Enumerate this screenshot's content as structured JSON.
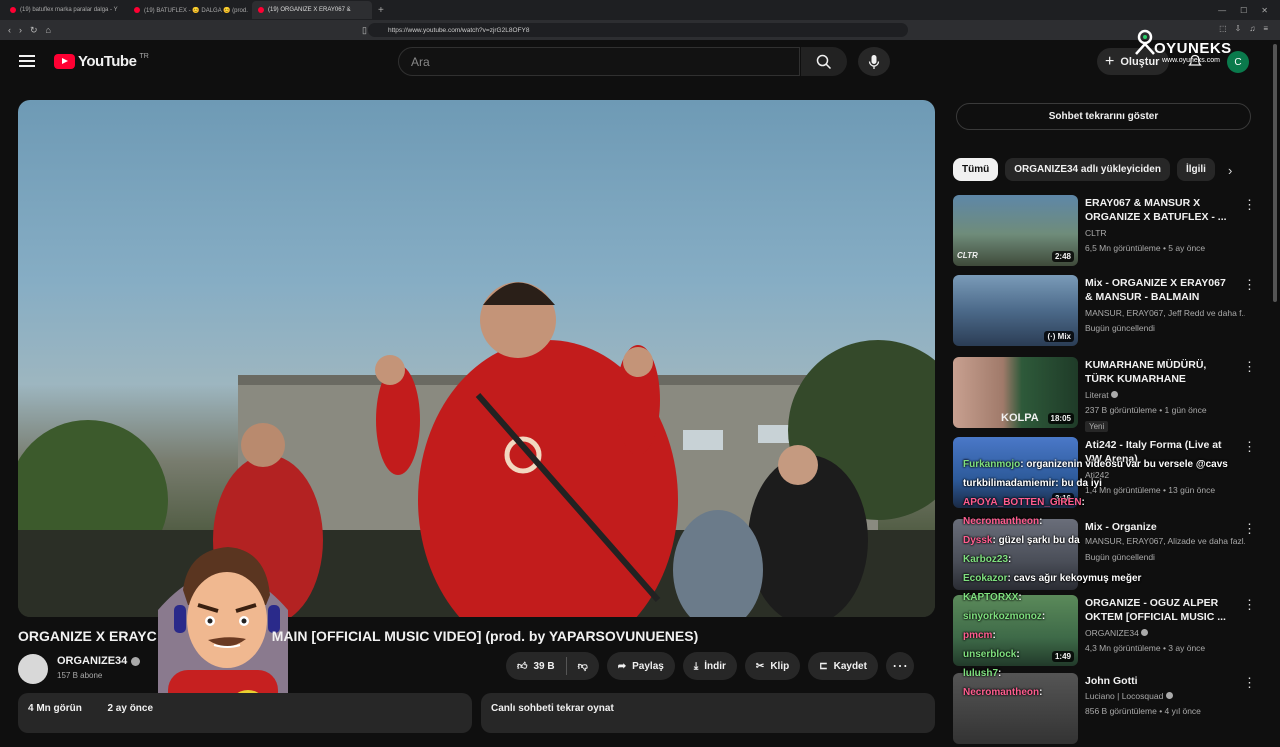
{
  "browser": {
    "tabs": [
      {
        "label": "(19) batuflex marka paralar dalga - Y"
      },
      {
        "label": "(19) BATUFLEX - 😊 DALGA 😊 (prod."
      },
      {
        "label": "(19) ORGANIZE X ERAY067 &"
      }
    ],
    "url": "https://www.youtube.com/watch?v=zjrG2L8OFY8"
  },
  "header": {
    "logo_text": "YouTube",
    "country_code": "TR",
    "search_placeholder": "Ara",
    "create_label": "Oluştur",
    "avatar_letter": "C"
  },
  "watermark": {
    "title": "OYUNEKS",
    "subtitle": "www.oyuneks.com"
  },
  "video": {
    "title": "ORGANIZE X ERAY067 & MANSUR - BALMAIN [OFFICIAL MUSIC VIDEO] (prod. by YAPARSOVUNUENES)",
    "title_visible_a": "ORGANIZE X ERAYC",
    "title_visible_b": "MAIN [OFFICIAL MUSIC VIDEO] (prod. by YAPARSOVUNUENES)",
    "channel_name": "ORGANIZE34",
    "subscribers": "157 B abone",
    "likes": "39 B",
    "share_label": "Paylaş",
    "download_label": "İndir",
    "clip_label": "Klip",
    "save_label": "Kaydet",
    "views_visible": "4 Mn görün",
    "date_visible": "2 ay önce",
    "chat_replay_label": "Canlı sohbeti tekrar oynat"
  },
  "sidebar": {
    "show_chat_label": "Sohbet tekrarını göster",
    "chips": [
      "Tümü",
      "ORGANIZE34 adlı yükleyiciden",
      "İlgili"
    ],
    "recommendations": [
      {
        "title": "ERAY067 & MANSUR X ORGANIZE X BATUFLEX - ...",
        "channel": "CLTR",
        "meta": "6,5 Mn görüntüleme • 5 ay önce",
        "duration": "2:48",
        "badge": "CLTR"
      },
      {
        "title": "Mix - ORGANIZE X ERAY067 & MANSUR - BALMAIN [OFFICIA...",
        "channel": "MANSUR, ERAY067, Jeff Redd ve daha f...",
        "meta": "Bugün güncellendi",
        "duration": "Mix"
      },
      {
        "title": "KUMARHANE MÜDÜRÜ, TÜRK KUMARHANE SAHNELERİNİ ...",
        "channel": "Literat",
        "meta": "237 B görüntüleme • 1 gün önce",
        "duration": "18:05",
        "new": "Yeni",
        "badge": "KOLPA"
      },
      {
        "title": "Ati242 - Italy Forma (Live at VW Arena)",
        "channel": "Ati242",
        "meta": "1,4 Mn görüntüleme • 13 gün önce",
        "duration": "3:16"
      },
      {
        "title": "Mix - Organize",
        "channel": "MANSUR, ERAY067, Alizade ve daha fazl...",
        "meta": "Bugün güncellendi",
        "duration": ""
      },
      {
        "title": "ORGANIZE - OGUZ ALPER OKTEM [OFFICIAL MUSIC ...",
        "channel": "ORGANIZE34",
        "meta": "4,3 Mn görüntüleme • 3 ay önce",
        "duration": "1:49"
      },
      {
        "title": "John Gotti",
        "channel": "Luciano | Locosquad",
        "meta": "856 B görüntüleme • 4 yıl önce",
        "duration": ""
      }
    ]
  },
  "chat": [
    {
      "name": "Furkanmojo",
      "msg": ": organizenin videosu var bu versele @cavs"
    },
    {
      "name": "turkbilimadamiemir",
      "msg": ": bu da iyi"
    },
    {
      "name": "APOYA_BOTTEN_GIREN",
      "msg": ":"
    },
    {
      "name": "Necromantheon",
      "msg": ":"
    },
    {
      "name": "Dyssk",
      "msg": ": güzel şarkı bu da"
    },
    {
      "name": "Karboz23",
      "msg": ":"
    },
    {
      "name": "Ecokazor",
      "msg": ": cavs ağır kekoymuş meğer"
    },
    {
      "name": "KAPTORXX",
      "msg": ":"
    },
    {
      "name": "sinyorkozmonoz",
      "msg": ":"
    },
    {
      "name": "pmcm",
      "msg": ":"
    },
    {
      "name": "unserblock",
      "msg": ":"
    },
    {
      "name": "lulush7",
      "msg": ":"
    },
    {
      "name": "Necromantheon",
      "msg": ":"
    }
  ]
}
